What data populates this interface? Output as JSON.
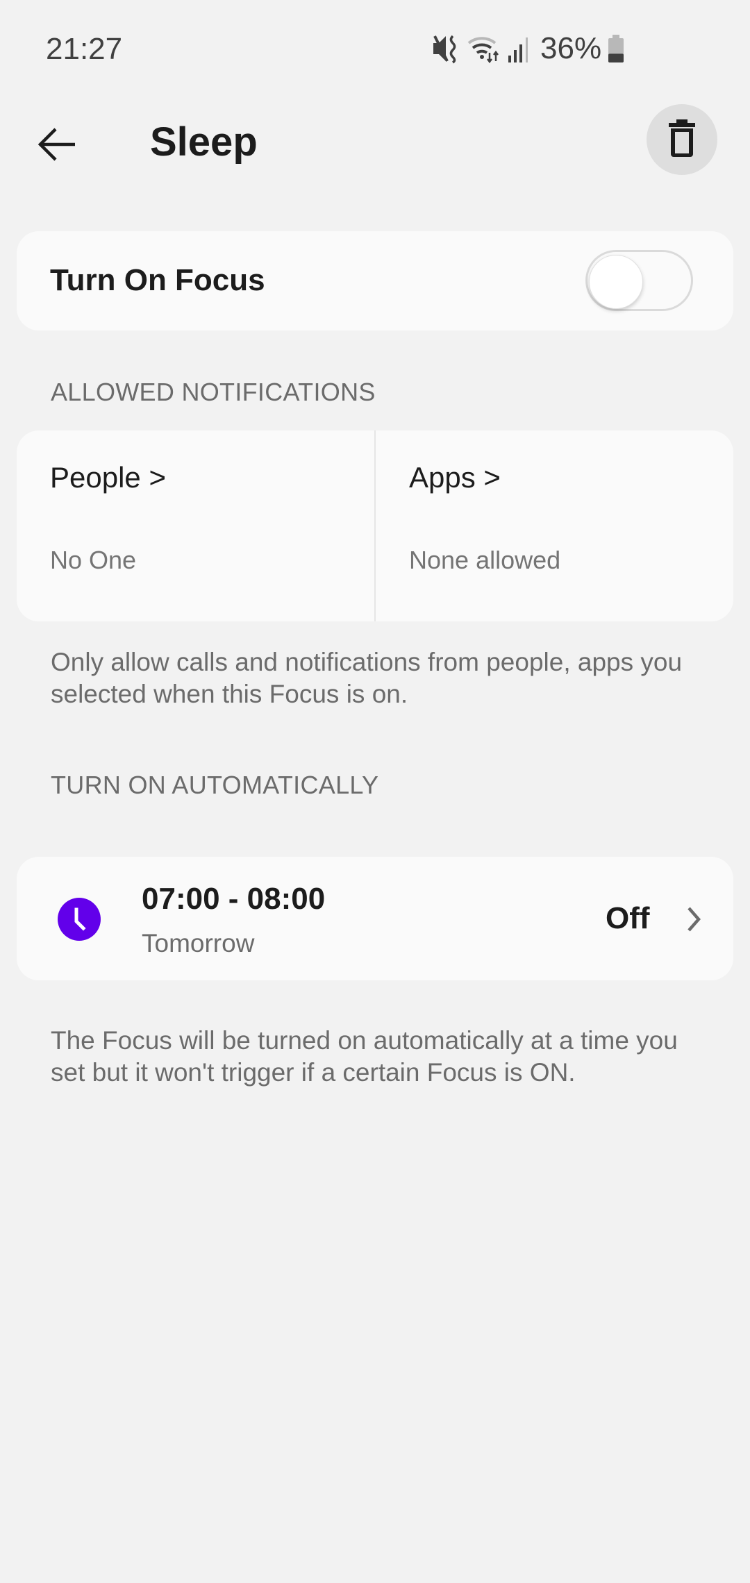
{
  "status_bar": {
    "time": "21:27",
    "icons": [
      "mute-vibrate-icon",
      "wifi-icon",
      "signal-icon",
      "battery-icon"
    ],
    "battery_percent": "36%",
    "battery_level": 0.36
  },
  "app_bar": {
    "back_icon": "arrow-left-icon",
    "title": "Sleep",
    "delete_icon": "trash-icon"
  },
  "focus_toggle": {
    "label": "Turn On Focus",
    "checked": false
  },
  "allowed_notifications": {
    "header": "ALLOWED NOTIFICATIONS",
    "columns": [
      {
        "title": "People >",
        "value": "No One"
      },
      {
        "title": "Apps >",
        "value": "None allowed"
      }
    ],
    "description": "Only allow calls and notifications from people, apps you selected when this Focus is on."
  },
  "turn_on_automatically": {
    "header": "TURN ON AUTOMATICALLY",
    "schedule": {
      "icon": "clock-icon",
      "time_range": "07:00 - 08:00",
      "day": "Tomorrow",
      "status": "Off"
    },
    "description": "The Focus will be turned on automatically at a time you set but it won't trigger if a certain Focus is ON."
  },
  "colors": {
    "background": "#f2f2f2",
    "card": "#fafafa",
    "accent": "#6200ea",
    "text_primary": "#1c1c1c",
    "text_secondary": "#6b6b6b"
  }
}
